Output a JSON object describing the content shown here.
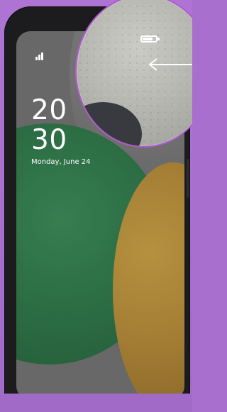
{
  "status_bar": {
    "signal_icon": "signal-bars-icon",
    "battery_icon": "battery-icon"
  },
  "clock": {
    "hour": "20",
    "minute": "30",
    "date": "Monday, June 24"
  },
  "annotation": {
    "pointer_icon": "arrow-left-icon"
  },
  "colors": {
    "background": "#a86fcf",
    "phone_frame": "#1c1c1f",
    "clock_text": "#ffffff",
    "magnifier_ring": "#b15ad0"
  }
}
